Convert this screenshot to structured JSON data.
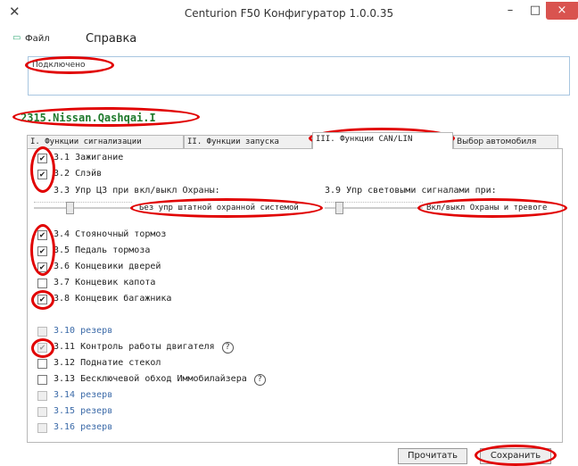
{
  "window": {
    "title": "Centurion F50 Конфигуратор 1.0.0.35",
    "app_icon": "tools-icon",
    "min_glyph": "–",
    "max_glyph": "□",
    "close_glyph": "×"
  },
  "menu": {
    "file": "Файл",
    "help": "Справка"
  },
  "status": {
    "text": "Подключено"
  },
  "car": {
    "label": "2315.Nissan.Qashqai.I"
  },
  "tabs": [
    {
      "label": "I. Функции сигнализации"
    },
    {
      "label": "II. Функции запуска"
    },
    {
      "label": "III. Функции CAN/LIN"
    },
    {
      "label": "Выбор автомобиля"
    }
  ],
  "rows": {
    "r31": {
      "label": "3.1  Зажигание"
    },
    "r32": {
      "label": "3.2  Слэйв"
    },
    "r33": {
      "label": "3.3  Упр ЦЗ при вкл/выкл Охраны:"
    },
    "r39": {
      "label": "3.9 Упр световыми сигналами при:"
    },
    "r34": {
      "label": "3.4  Стояночный тормоз"
    },
    "r35": {
      "label": "3.5  Педаль тормоза"
    },
    "r36": {
      "label": "3.6  Концевики дверей"
    },
    "r37": {
      "label": "3.7  Концевик капота"
    },
    "r38": {
      "label": "3.8  Концевик багажника"
    },
    "r310": {
      "label": "3.10 резерв"
    },
    "r311": {
      "label": "3.11 Контроль работы двигателя"
    },
    "r312": {
      "label": "3.12 Поднатие стекол"
    },
    "r313": {
      "label": "3.13 Бесключевой обход Иммобилайзера"
    },
    "r314": {
      "label": "3.14 резерв"
    },
    "r315": {
      "label": "3.15 резерв"
    },
    "r316": {
      "label": "3.16 резерв"
    }
  },
  "sliders": {
    "s33": {
      "value": "Без упр штатной охранной системой"
    },
    "s39": {
      "value": "Вкл/выкл Охраны и тревоге"
    }
  },
  "help_glyph": "?",
  "buttons": {
    "read": "Прочитать",
    "save": "Сохранить"
  },
  "colors": {
    "highlight": "#e10000",
    "car_label": "#1f7a2c",
    "reserve_text": "#3b6aa8"
  }
}
